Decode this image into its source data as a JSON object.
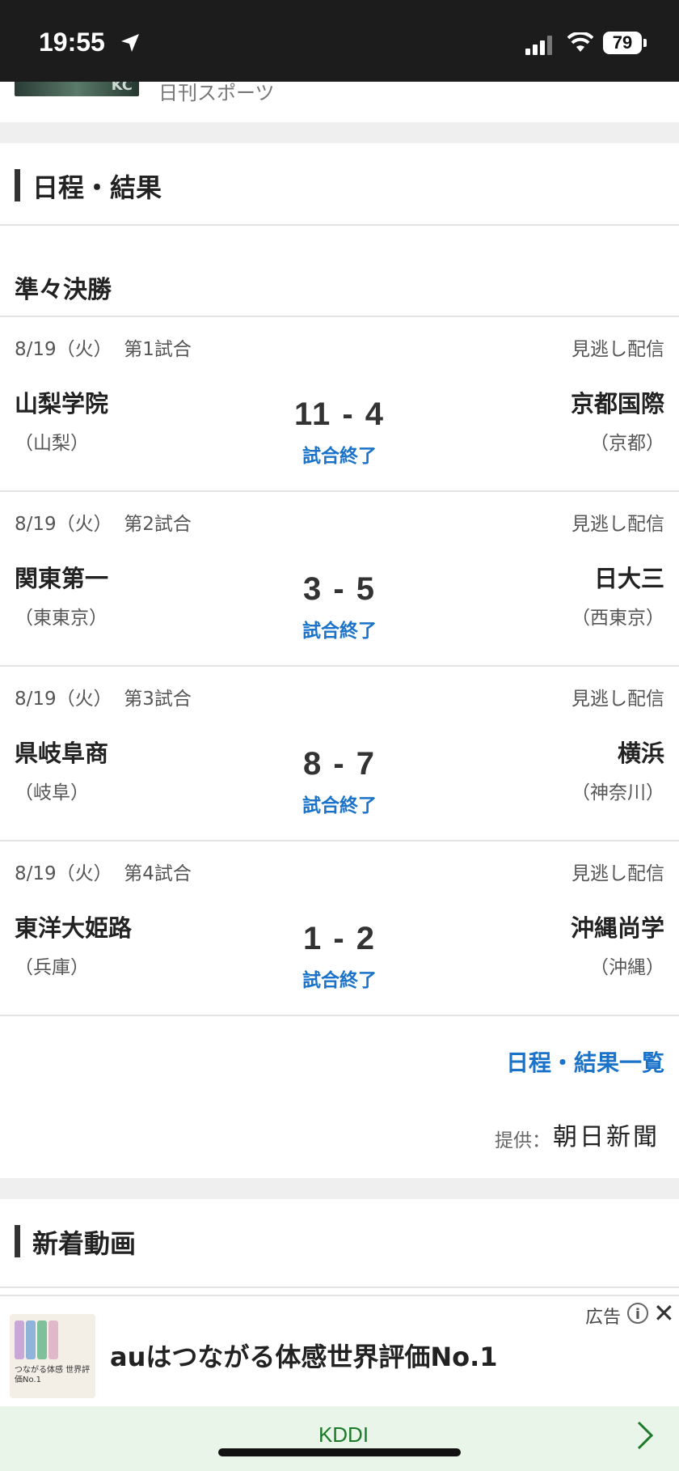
{
  "status_bar": {
    "time": "19:55",
    "battery": "79"
  },
  "prev_item": {
    "thumb_text": "KC",
    "source": "日刊スポーツ"
  },
  "schedule": {
    "title": "日程・結果",
    "round": "準々決勝",
    "games": [
      {
        "date": "8/19（火）",
        "slot": "第1試合",
        "replay": "見逃し配信",
        "home": "山梨学院",
        "home_pref": "（山梨）",
        "score": "11 - 4",
        "status": "試合終了",
        "away": "京都国際",
        "away_pref": "（京都）"
      },
      {
        "date": "8/19（火）",
        "slot": "第2試合",
        "replay": "見逃し配信",
        "home": "関東第一",
        "home_pref": "（東東京）",
        "score": "3 - 5",
        "status": "試合終了",
        "away": "日大三",
        "away_pref": "（西東京）"
      },
      {
        "date": "8/19（火）",
        "slot": "第3試合",
        "replay": "見逃し配信",
        "home": "県岐阜商",
        "home_pref": "（岐阜）",
        "score": "8 - 7",
        "status": "試合終了",
        "away": "横浜",
        "away_pref": "（神奈川）"
      },
      {
        "date": "8/19（火）",
        "slot": "第4試合",
        "replay": "見逃し配信",
        "home": "東洋大姫路",
        "home_pref": "（兵庫）",
        "score": "1 - 2",
        "status": "試合終了",
        "away": "沖縄尚学",
        "away_pref": "（沖縄）"
      }
    ],
    "all_results_link": "日程・結果一覧",
    "credit_label": "提供：",
    "credit_name": "朝日新聞"
  },
  "videos": {
    "title": "新着動画"
  },
  "ad": {
    "label": "広告",
    "headline": "auはつながる体感世界評価No.1",
    "image_text": "つながる体感 世界評価No.1",
    "cta": "KDDI"
  },
  "colors": {
    "link": "#1a73c8",
    "cta_text": "#1a7a2a",
    "cta_bg": "#e9f5e8"
  }
}
